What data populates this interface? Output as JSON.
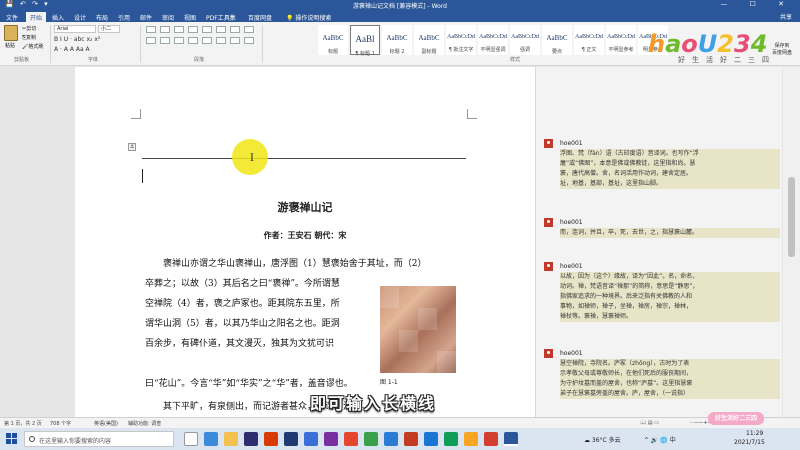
{
  "window": {
    "title": "游褒禅山记文档 [兼容模式] - Word",
    "quick_access": "💾 ↶ ↷ ▾",
    "controls": "— ☐ ✕"
  },
  "tabs": [
    "文件",
    "开始",
    "插入",
    "设计",
    "布局",
    "引用",
    "邮件",
    "审阅",
    "视图",
    "PDF工具集",
    "百度网盘",
    "💡 操作说明搜索"
  ],
  "share_label": "共享",
  "ribbon": {
    "clipboard": {
      "paste": "粘贴",
      "cut": "✂剪切",
      "copy": "⎘复制",
      "format_painter": "🖌格式刷",
      "group": "剪贴板"
    },
    "font": {
      "name": "Arial",
      "size": "小二",
      "group": "字体",
      "buttons": "B I U · abc x₂ x²",
      "buttons2": "A · A A Aa A"
    },
    "paragraph": {
      "group": "段落"
    },
    "styles": {
      "group": "样式",
      "items": [
        {
          "preview": "AaBbC",
          "name": "标题"
        },
        {
          "preview": "AaBl",
          "name": "¶ 标题 1"
        },
        {
          "preview": "AaBbC",
          "name": "标题 2"
        },
        {
          "preview": "AaBbC",
          "name": "副标题"
        },
        {
          "preview": "AaBbCcDd",
          "name": "¶ 批注文字"
        },
        {
          "preview": "AaBbCcDd",
          "name": "不明显强调"
        },
        {
          "preview": "AaBbCcDd",
          "name": "强调"
        },
        {
          "preview": "AaBbC",
          "name": "要点"
        },
        {
          "preview": "AaBbCcDd",
          "name": "¶ 正文"
        },
        {
          "preview": "AaBbCcDd",
          "name": "不明显参考"
        },
        {
          "preview": "AaBbCcDd",
          "name": "明显参考"
        }
      ]
    },
    "save_baidu": "保存到\n百度网盘"
  },
  "brand": {
    "logo": "haoU234",
    "tagline": "好生活好二三四",
    "colors": [
      "#f3992b",
      "#6fba2c",
      "#e94e77",
      "#3ea1e8",
      "#f3c12b"
    ]
  },
  "document": {
    "title": "游褒禅山记",
    "subtitle": "作者：王安石   朝代：宋",
    "lines": [
      "褒禅山亦谓之华山褒禅山，唐浮图（1）慧褒始舍于其址，而（2）",
      "卒葬之；以故（3）其后名之曰“褒禅”。今所谓慧",
      "空禅院（4）者，褒之庐冢也。距其院东五里，所",
      "谓华山洞（5）者，以其乃华山之阳名之也。距洞",
      "百余步，有碑仆道，其文漫灭，独其为文犹可识",
      "曰“花山”。今言“华”如“华实”之“华”者，盖音谬也。",
      "其下平旷，有泉侧出，而记游者甚众，所谓前洞也。"
    ],
    "figure_caption": "图 1-1"
  },
  "comments": [
    {
      "author": "hoe001",
      "lines": [
        "浮图、梵（fàn）语（古印度语）音译词。也写作“浮",
        "屠”或“佛图”，本意是佛或佛教徒，这里指和尚。慧",
        "褒，唐代高僧。舍，名词活用作动词，建舍定居。",
        "址，地基，基部，基址，这里指山脚。"
      ]
    },
    {
      "author": "hoe001",
      "lines": [
        "而，连词，并且，卒，死，去世，之，指慧褒山麓。"
      ]
    },
    {
      "author": "hoe001",
      "lines": [
        "以故，因为（这个）缘故，译为“因此”。名，命名，",
        "动词。禅，梵语音译“禅那”的简称，意思是“静思”，",
        "指佛家追求的一种境界。后来泛指有关佛教的人和",
        "事物，如禅师，禅子，坐禅，禅房，禅宗，禅林，",
        "禅杖等。褒禅，慧褒禅师。"
      ]
    },
    {
      "author": "hoe001",
      "lines": [
        "慧空禅院，寺院名。庐冢（zhǒng），古时为了表",
        "示孝敬父母或尊敬师长，在他们死后的服丧期间，",
        "为守护坟墓而盖的屋舍，也称“庐墓”。这里指慧褒",
        "弟子在慧褒墓旁盖的屋舍。庐，屋舍，（一说指）"
      ]
    }
  ],
  "statusbar": {
    "page": "第 1 页，共 2 页",
    "words": "708 个字",
    "lang": "英语(美国)",
    "a11y": "辅助功能: 调查",
    "views": "📖 ▤ ▭",
    "zoom": "- ——+—— + 130%"
  },
  "taskbar": {
    "search_placeholder": "在这里输入你要搜索的内容",
    "weather": "☁ 36°C 多云",
    "time": "11:29",
    "date": "2021/7/15",
    "tray_icons": "^ 🔊 🌐 中"
  },
  "overlay": {
    "caption": "即可输入长横线",
    "badge": "好生活好二三四"
  }
}
